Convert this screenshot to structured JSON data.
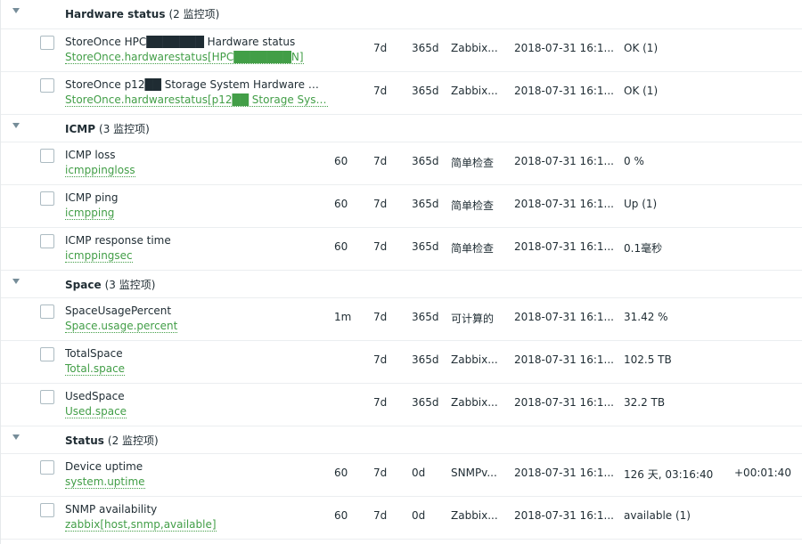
{
  "groups": [
    {
      "name": "Hardware status",
      "count": "(2 监控项)",
      "items": [
        {
          "name": "StoreOnce HPC███████ Hardware status",
          "key": "StoreOnce.hardwarestatus[HPC███████N]",
          "interval": "",
          "history": "7d",
          "trends": "365d",
          "type": "Zabbix...",
          "last_check": "2018-07-31 16:1...",
          "last_value": "OK (1)",
          "change": ""
        },
        {
          "name": "StoreOnce p12██ Storage System Hardware st...",
          "key": "StoreOnce.hardwarestatus[p12██ Storage Syst...",
          "interval": "",
          "history": "7d",
          "trends": "365d",
          "type": "Zabbix...",
          "last_check": "2018-07-31 16:1...",
          "last_value": "OK (1)",
          "change": ""
        }
      ]
    },
    {
      "name": "ICMP",
      "count": "(3 监控项)",
      "items": [
        {
          "name": "ICMP loss",
          "key": "icmppingloss",
          "interval": "60",
          "history": "7d",
          "trends": "365d",
          "type": "简单检查",
          "last_check": "2018-07-31 16:1...",
          "last_value": "0 %",
          "change": ""
        },
        {
          "name": "ICMP ping",
          "key": "icmpping",
          "interval": "60",
          "history": "7d",
          "trends": "365d",
          "type": "简单检查",
          "last_check": "2018-07-31 16:1...",
          "last_value": "Up (1)",
          "change": ""
        },
        {
          "name": "ICMP response time",
          "key": "icmppingsec",
          "interval": "60",
          "history": "7d",
          "trends": "365d",
          "type": "简单检查",
          "last_check": "2018-07-31 16:1...",
          "last_value": "0.1毫秒",
          "change": ""
        }
      ]
    },
    {
      "name": "Space",
      "count": "(3 监控项)",
      "items": [
        {
          "name": "SpaceUsagePercent",
          "key": "Space.usage.percent",
          "interval": "1m",
          "history": "7d",
          "trends": "365d",
          "type": "可计算的",
          "last_check": "2018-07-31 16:1...",
          "last_value": "31.42 %",
          "change": ""
        },
        {
          "name": "TotalSpace",
          "key": "Total.space",
          "interval": "",
          "history": "7d",
          "trends": "365d",
          "type": "Zabbix...",
          "last_check": "2018-07-31 16:1...",
          "last_value": "102.5 TB",
          "change": ""
        },
        {
          "name": "UsedSpace",
          "key": "Used.space",
          "interval": "",
          "history": "7d",
          "trends": "365d",
          "type": "Zabbix...",
          "last_check": "2018-07-31 16:1...",
          "last_value": "32.2 TB",
          "change": ""
        }
      ]
    },
    {
      "name": "Status",
      "count": "(2 监控项)",
      "items": [
        {
          "name": "Device uptime",
          "key": "system.uptime",
          "interval": "60",
          "history": "7d",
          "trends": "0d",
          "type": "SNMPv...",
          "last_check": "2018-07-31 16:1...",
          "last_value": "126 天, 03:16:40",
          "change": "+00:01:40"
        },
        {
          "name": "SNMP availability",
          "key": "zabbix[host,snmp,available]",
          "interval": "60",
          "history": "7d",
          "trends": "0d",
          "type": "Zabbix...",
          "last_check": "2018-07-31 16:1...",
          "last_value": "available (1)",
          "change": ""
        }
      ]
    }
  ]
}
